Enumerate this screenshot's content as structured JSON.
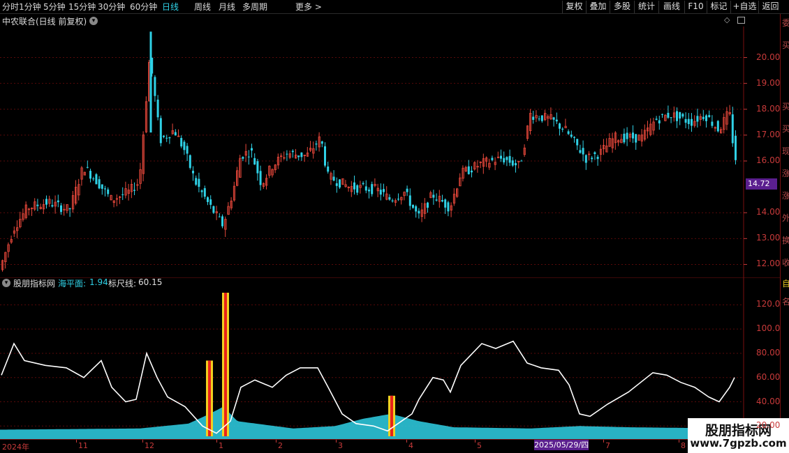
{
  "toolbar": {
    "periods": [
      {
        "label": "分时",
        "active": false
      },
      {
        "label": "1分钟",
        "active": false
      },
      {
        "label": "5分钟",
        "active": false
      },
      {
        "label": "15分钟",
        "active": false
      },
      {
        "label": "30分钟",
        "active": false
      },
      {
        "label": "60分钟",
        "active": false
      },
      {
        "label": "日线",
        "active": true
      },
      {
        "label": "周线",
        "active": false
      },
      {
        "label": "月线",
        "active": false
      },
      {
        "label": "多周期",
        "active": false
      }
    ],
    "more": "更多 >",
    "buttons": [
      "复权",
      "叠加",
      "多股",
      "统计",
      "画线",
      "F10",
      "标记",
      "+自选",
      "返回"
    ]
  },
  "main_chart": {
    "title": "中农联合(日线 前复权)",
    "price_ticks": [
      "20.00",
      "19.00",
      "18.00",
      "17.00",
      "16.00",
      "14.00",
      "13.00",
      "12.00"
    ],
    "current_price": "14.72"
  },
  "indicator": {
    "name": "股朋指标网",
    "sea_label": "海平面:",
    "sea_value": "1.94",
    "rule_label": "标尺线:",
    "rule_value": "60.15",
    "ticks": [
      "120.0",
      "100.0",
      "80.00",
      "60.00",
      "40.00",
      "20.00"
    ]
  },
  "x_axis": {
    "labels": [
      "2024年",
      "11",
      "12",
      "1",
      "2",
      "3",
      "4",
      "5",
      "7",
      "8"
    ],
    "cursor_date": "2025/05/29/四"
  },
  "right_strip": [
    "委",
    "买",
    "买",
    "买",
    "现",
    "涨",
    "涨",
    "外",
    "换",
    "收",
    "自",
    "名"
  ],
  "colors": {
    "up": "#e8483b",
    "down": "#2fd1e6",
    "line": "#ffffff",
    "bar_red": "#e8221a",
    "bar_yellow": "#f0d020",
    "grid": "#5a0a0a"
  },
  "watermark": {
    "title": "股朋指标网",
    "url": "www.7gpzb.com"
  },
  "chart_data": [
    {
      "type": "candlestick",
      "title": "",
      "ylim": [
        11.5,
        21.2
      ],
      "anchors": [
        [
          0,
          11.8
        ],
        [
          20,
          13.4
        ],
        [
          40,
          14.2
        ],
        [
          70,
          14.4
        ],
        [
          100,
          14.1
        ],
        [
          120,
          15.8
        ],
        [
          140,
          15.2
        ],
        [
          160,
          14.5
        ],
        [
          185,
          14.8
        ],
        [
          200,
          15.2
        ],
        [
          215,
          20.1
        ],
        [
          230,
          16.8
        ],
        [
          250,
          17.2
        ],
        [
          265,
          16.4
        ],
        [
          280,
          15.2
        ],
        [
          300,
          14.3
        ],
        [
          320,
          13.5
        ],
        [
          335,
          14.9
        ],
        [
          345,
          16.2
        ],
        [
          360,
          16.4
        ],
        [
          375,
          15.1
        ],
        [
          390,
          15.8
        ],
        [
          410,
          16.3
        ],
        [
          440,
          16.2
        ],
        [
          460,
          16.9
        ],
        [
          470,
          15.4
        ],
        [
          500,
          15.0
        ],
        [
          540,
          14.9
        ],
        [
          560,
          14.5
        ],
        [
          580,
          14.8
        ],
        [
          600,
          13.8
        ],
        [
          620,
          14.7
        ],
        [
          645,
          14.2
        ],
        [
          660,
          15.5
        ],
        [
          690,
          15.9
        ],
        [
          720,
          16.1
        ],
        [
          745,
          15.8
        ],
        [
          760,
          17.8
        ],
        [
          790,
          17.6
        ],
        [
          810,
          17.2
        ],
        [
          840,
          16.1
        ],
        [
          860,
          16.3
        ],
        [
          880,
          16.9
        ],
        [
          920,
          16.9
        ],
        [
          940,
          17.6
        ],
        [
          960,
          17.8
        ],
        [
          990,
          17.5
        ],
        [
          1010,
          17.8
        ],
        [
          1030,
          17.2
        ],
        [
          1045,
          17.9
        ],
        [
          1053,
          16.1
        ]
      ]
    },
    {
      "type": "line",
      "title": "",
      "ylim": [
        15,
        130
      ],
      "series": [
        {
          "name": "",
          "points": [
            [
              2,
              62
            ],
            [
              20,
              88
            ],
            [
              35,
              74
            ],
            [
              65,
              70
            ],
            [
              95,
              68
            ],
            [
              120,
              60
            ],
            [
              145,
              74
            ],
            [
              160,
              52
            ],
            [
              180,
              40
            ],
            [
              195,
              42
            ],
            [
              210,
              80
            ],
            [
              225,
              60
            ],
            [
              240,
              44
            ],
            [
              265,
              36
            ],
            [
              290,
              20
            ],
            [
              310,
              14
            ],
            [
              330,
              24
            ],
            [
              345,
              52
            ],
            [
              365,
              58
            ],
            [
              390,
              52
            ],
            [
              410,
              62
            ],
            [
              430,
              68
            ],
            [
              455,
              68
            ],
            [
              470,
              52
            ],
            [
              490,
              30
            ],
            [
              510,
              22
            ],
            [
              535,
              20
            ],
            [
              555,
              16
            ],
            [
              575,
              24
            ],
            [
              590,
              30
            ],
            [
              600,
              42
            ],
            [
              620,
              60
            ],
            [
              635,
              58
            ],
            [
              645,
              48
            ],
            [
              660,
              70
            ],
            [
              690,
              88
            ],
            [
              710,
              84
            ],
            [
              735,
              90
            ],
            [
              755,
              72
            ],
            [
              775,
              68
            ],
            [
              800,
              66
            ],
            [
              815,
              54
            ],
            [
              830,
              30
            ],
            [
              845,
              28
            ],
            [
              870,
              38
            ],
            [
              900,
              48
            ],
            [
              935,
              64
            ],
            [
              955,
              62
            ],
            [
              975,
              56
            ],
            [
              995,
              52
            ],
            [
              1015,
              44
            ],
            [
              1030,
              40
            ],
            [
              1045,
              52
            ],
            [
              1052,
              60
            ]
          ]
        },
        {
          "name": "海平面",
          "points": [
            [
              2,
              1
            ],
            [
              200,
              2
            ],
            [
              270,
              6
            ],
            [
              300,
              14
            ],
            [
              320,
              20
            ],
            [
              340,
              8
            ],
            [
              420,
              2
            ],
            [
              480,
              4
            ],
            [
              520,
              10
            ],
            [
              560,
              14
            ],
            [
              600,
              8
            ],
            [
              650,
              3
            ],
            [
              760,
              2
            ],
            [
              830,
              4
            ],
            [
              900,
              3
            ],
            [
              1052,
              2
            ]
          ]
        }
      ],
      "bars": [
        {
          "x": 300,
          "value": 74
        },
        {
          "x": 323,
          "value": 130
        },
        {
          "x": 561,
          "value": 45
        }
      ]
    }
  ]
}
